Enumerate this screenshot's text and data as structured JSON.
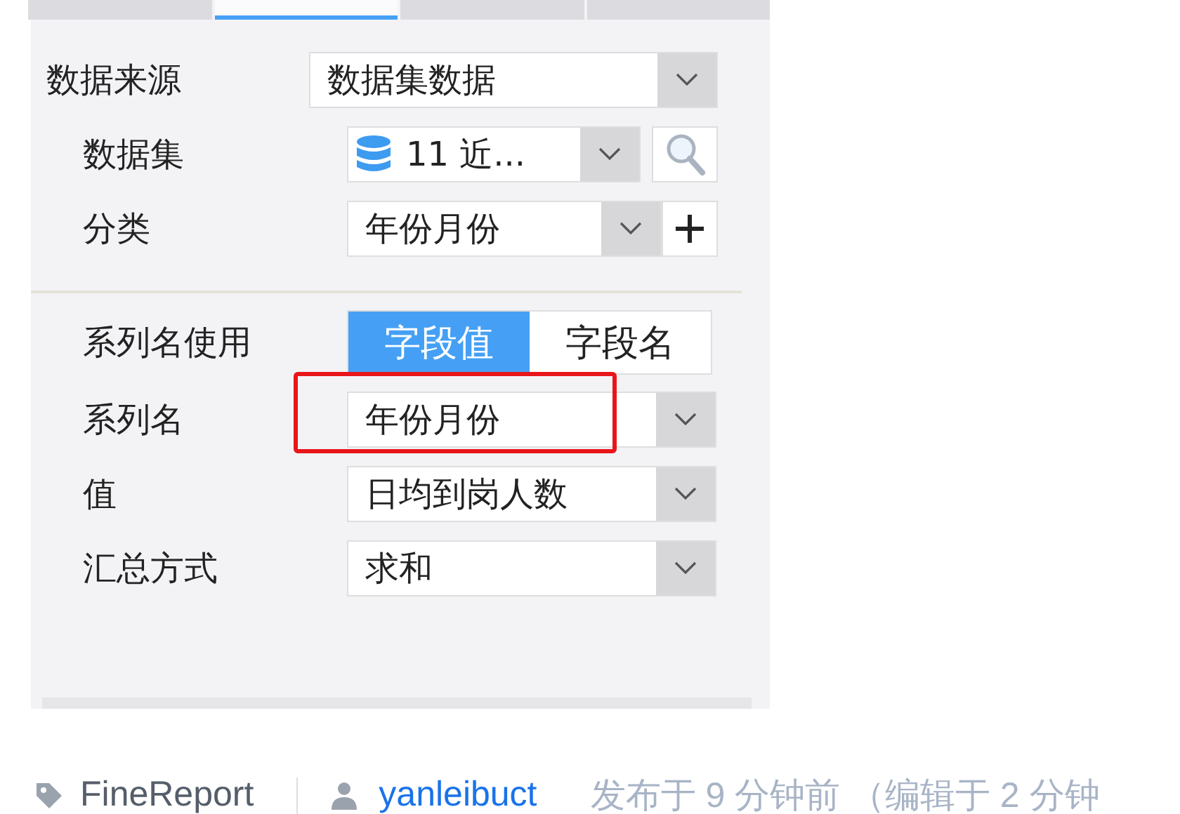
{
  "tabs": [
    {
      "selected": false
    },
    {
      "selected": true
    },
    {
      "selected": false
    },
    {
      "selected": false
    }
  ],
  "data_source": {
    "label": "数据来源",
    "value": "数据集数据"
  },
  "dataset": {
    "label": "数据集",
    "value": "11 近..."
  },
  "category": {
    "label": "分类",
    "value": "年份月份"
  },
  "series_name_use": {
    "label": "系列名使用",
    "options": [
      {
        "label": "字段值",
        "selected": true
      },
      {
        "label": "字段名",
        "selected": false
      }
    ]
  },
  "fields": [
    {
      "label": "系列名",
      "value": "年份月份",
      "highlighted": true
    },
    {
      "label": "值",
      "value": "日均到岗人数",
      "highlighted": false
    },
    {
      "label": "汇总方式",
      "value": "求和",
      "highlighted": false
    }
  ],
  "footer": {
    "tag": "FineReport",
    "author": "yanleibuct",
    "meta": "发布于 9 分钟前 （编辑于 2 分钟"
  }
}
